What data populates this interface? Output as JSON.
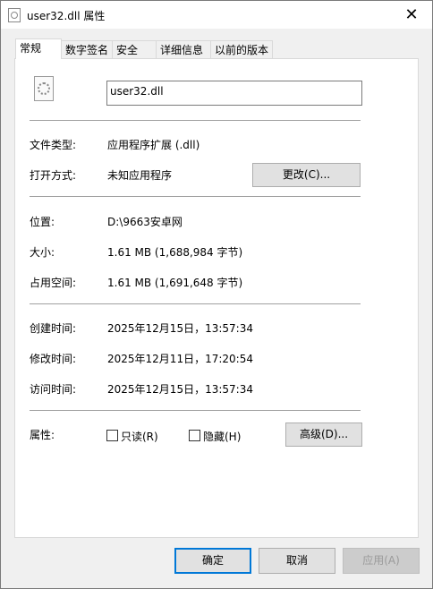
{
  "window": {
    "title": "user32.dll 属性",
    "close_glyph": "✕"
  },
  "tabs": [
    "常规",
    "数字签名",
    "安全",
    "详细信息",
    "以前的版本"
  ],
  "general": {
    "file_name": "user32.dll",
    "type_label": "文件类型:",
    "type_value": "应用程序扩展 (.dll)",
    "opens_label": "打开方式:",
    "opens_value": "未知应用程序",
    "change_button": "更改(C)...",
    "location_label": "位置:",
    "location_value": "D:\\9663安卓网",
    "size_label": "大小:",
    "size_value": "1.61 MB (1,688,984 字节)",
    "disk_label": "占用空间:",
    "disk_value": "1.61 MB (1,691,648 字节)",
    "created_label": "创建时间:",
    "created_value": "2025年12月15日，13:57:34",
    "modified_label": "修改时间:",
    "modified_value": "2025年12月11日，17:20:54",
    "accessed_label": "访问时间:",
    "accessed_value": "2025年12月15日，13:57:34",
    "attributes_label": "属性:",
    "readonly_label": "只读(R)",
    "hidden_label": "隐藏(H)",
    "advanced_button": "高级(D)..."
  },
  "footer": {
    "ok": "确定",
    "cancel": "取消",
    "apply": "应用(A)"
  }
}
